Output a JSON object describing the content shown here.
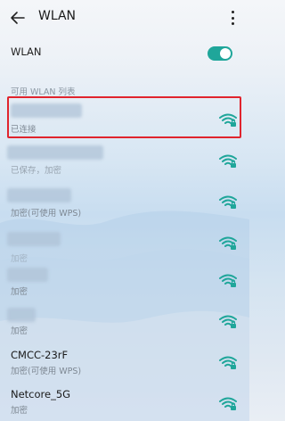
{
  "header": {
    "title": "WLAN"
  },
  "wlan_toggle": {
    "label": "WLAN",
    "state": "on",
    "color": "#1fa69a"
  },
  "section": {
    "label": "可用 WLAN 列表"
  },
  "networks": [
    {
      "name": "",
      "status": "已连接",
      "secured": true,
      "name_obscured": true,
      "highlighted": true
    },
    {
      "name": "",
      "status": "已保存，加密",
      "secured": true,
      "name_obscured": true
    },
    {
      "name": "",
      "status": "加密(可使用 WPS)",
      "secured": true,
      "name_obscured": true
    },
    {
      "name": "",
      "status": "加密",
      "secured": true,
      "name_obscured": true
    },
    {
      "name": "",
      "status": "加密",
      "secured": true,
      "name_obscured": true
    },
    {
      "name": "",
      "status": "加密",
      "secured": true,
      "name_obscured": true
    },
    {
      "name": "CMCC-23rF",
      "status": "加密(可使用 WPS)",
      "secured": true
    },
    {
      "name": "Netcore_5G",
      "status": "加密",
      "secured": true
    }
  ],
  "colors": {
    "accent": "#1fa69a",
    "highlight": "#e0242d"
  }
}
